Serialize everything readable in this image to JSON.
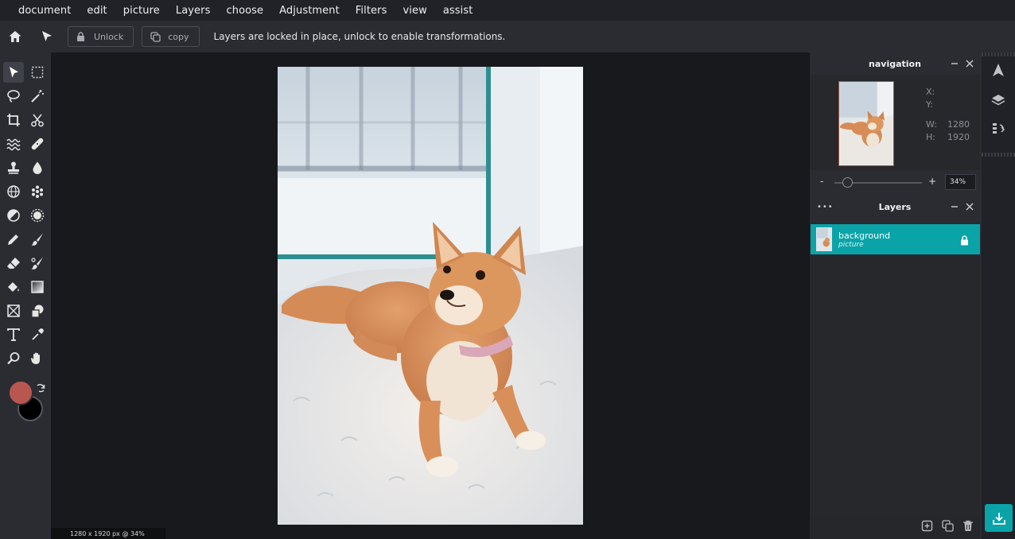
{
  "menu": [
    "document",
    "edit",
    "picture",
    "Layers",
    "choose",
    "Adjustment",
    "Filters",
    "view",
    "assist"
  ],
  "toolbar": {
    "unlock_label": "Unlock",
    "copy_label": "copy",
    "message": "Layers are locked in place, unlock to enable transformations."
  },
  "toolbox": {
    "foreground_color": "#b8574f",
    "background_color": "#000000",
    "tools": [
      "move",
      "marquee",
      "lasso",
      "magic-wand",
      "crop",
      "cut",
      "liquify",
      "healing",
      "clone-stamp",
      "blur",
      "sharpen",
      "sponge",
      "dodge",
      "burn",
      "pencil",
      "brush",
      "eraser",
      "color-replace",
      "paint-bucket",
      "gradient",
      "shape",
      "shape-library",
      "text",
      "eyedropper",
      "zoom",
      "hand"
    ]
  },
  "status": "1280 x 1920 px @ 34%",
  "navigation": {
    "title": "navigation",
    "x_label": "X:",
    "y_label": "Y:",
    "w_label": "W:",
    "h_label": "H:",
    "width": "1280",
    "height": "1920",
    "zoom_minus": "-",
    "zoom_plus": "+",
    "zoom": "34%",
    "zoom_level": 0.34
  },
  "layers": {
    "title": "Layers",
    "menu_dots": "•••",
    "items": [
      {
        "name": "background",
        "type": "picture",
        "locked": true
      }
    ]
  },
  "colors": {
    "accent": "#0aa3a8",
    "thumb_border": "#a6553d"
  }
}
